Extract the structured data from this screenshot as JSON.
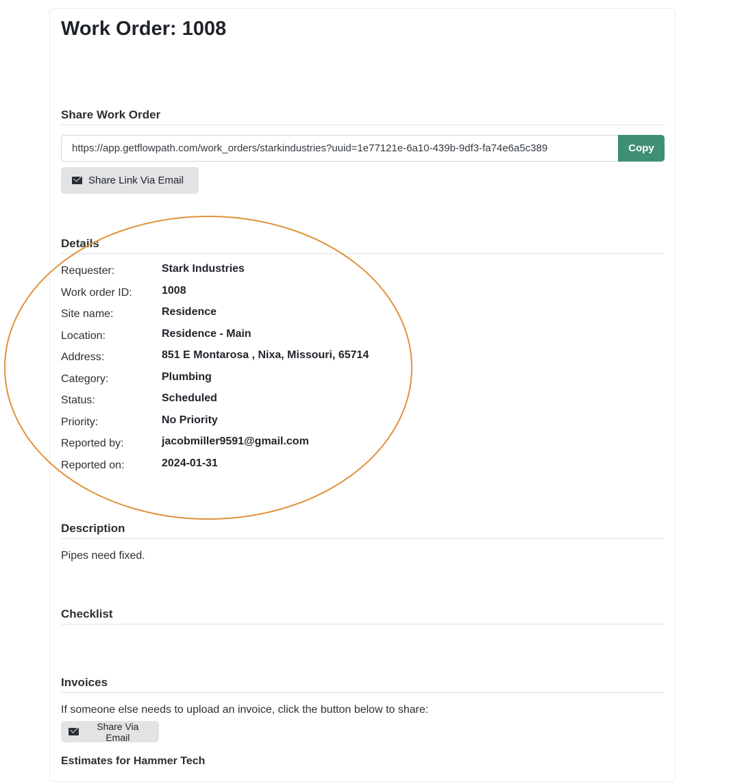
{
  "page": {
    "title": "Work Order: 1008"
  },
  "share": {
    "heading": "Share Work Order",
    "url_value": "https://app.getflowpath.com/work_orders/starkindustries?uuid=1e77121e-6a10-439b-9df3-fa74e6a5c389",
    "copy_label": "Copy",
    "email_button_label": "Share Link Via Email"
  },
  "details": {
    "heading": "Details",
    "rows": [
      {
        "label": "Requester:",
        "value": "Stark Industries"
      },
      {
        "label": "Work order ID:",
        "value": "1008"
      },
      {
        "label": "Site name:",
        "value": "Residence"
      },
      {
        "label": "Location:",
        "value": "Residence - Main"
      },
      {
        "label": "Address:",
        "value": "851 E Montarosa , Nixa, Missouri, 65714"
      },
      {
        "label": "Category:",
        "value": "Plumbing"
      },
      {
        "label": "Status:",
        "value": "Scheduled"
      },
      {
        "label": "Priority:",
        "value": "No Priority"
      },
      {
        "label": "Reported by:",
        "value": "jacobmiller9591@gmail.com"
      },
      {
        "label": "Reported on:",
        "value": "2024-01-31"
      }
    ]
  },
  "description": {
    "heading": "Description",
    "text": "Pipes need fixed."
  },
  "checklist": {
    "heading": "Checklist"
  },
  "invoices": {
    "heading": "Invoices",
    "text": "If someone else needs to upload an invoice, click the button below to share:",
    "email_button_label": "Share Via Email"
  },
  "estimates": {
    "heading": "Estimates for Hammer Tech"
  },
  "colors": {
    "copy_button": "#3f8f74",
    "secondary_button": "#e2e3e5",
    "annotation_circle": "#e0913a"
  },
  "icons": {
    "email": "envelope-icon"
  }
}
